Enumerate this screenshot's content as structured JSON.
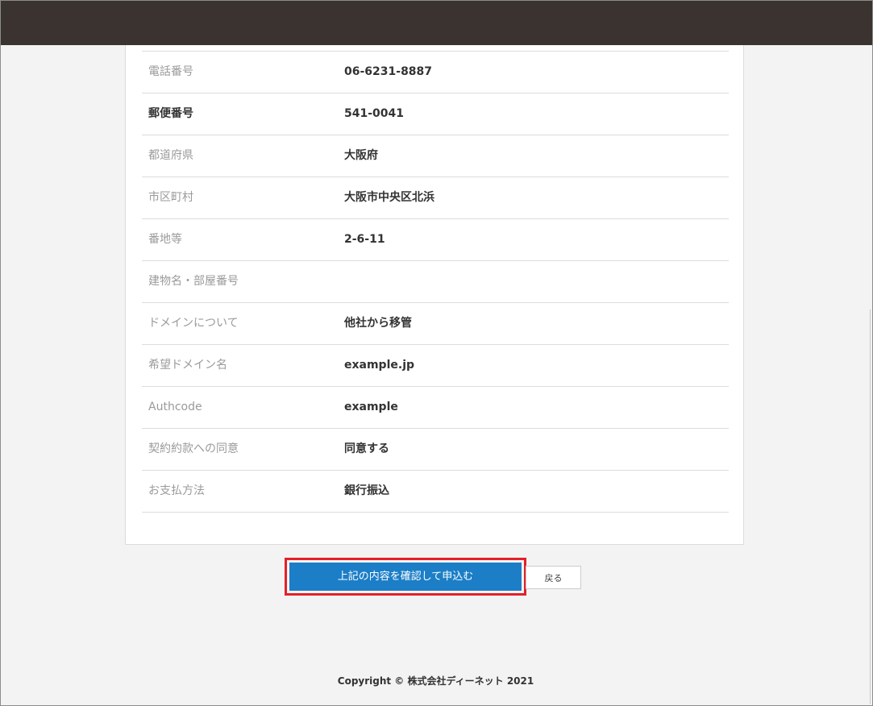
{
  "confirmation": {
    "rows": [
      {
        "label": "電話番号",
        "value": "06-6231-8887"
      },
      {
        "label": "郵便番号",
        "value": "541-0041"
      },
      {
        "label": "都道府県",
        "value": "大阪府"
      },
      {
        "label": "市区町村",
        "value": "大阪市中央区北浜"
      },
      {
        "label": "番地等",
        "value": "2-6-11"
      },
      {
        "label": "建物名・部屋番号",
        "value": ""
      },
      {
        "label": "ドメインについて",
        "value": "他社から移管"
      },
      {
        "label": "希望ドメイン名",
        "value": "example.jp"
      },
      {
        "label": "Authcode",
        "value": "example"
      },
      {
        "label": "契約約款への同意",
        "value": "同意する"
      },
      {
        "label": "お支払方法",
        "value": "銀行振込"
      }
    ]
  },
  "actions": {
    "submit_label": "上記の内容を確認して申込む",
    "back_label": "戻る"
  },
  "footer": {
    "copyright": "Copyright © 株式会社ディーネット 2021"
  },
  "colors": {
    "header": "#3a3330",
    "submit": "#1c7ec7",
    "highlight": "#e3202a",
    "background": "#f3f3f3"
  }
}
